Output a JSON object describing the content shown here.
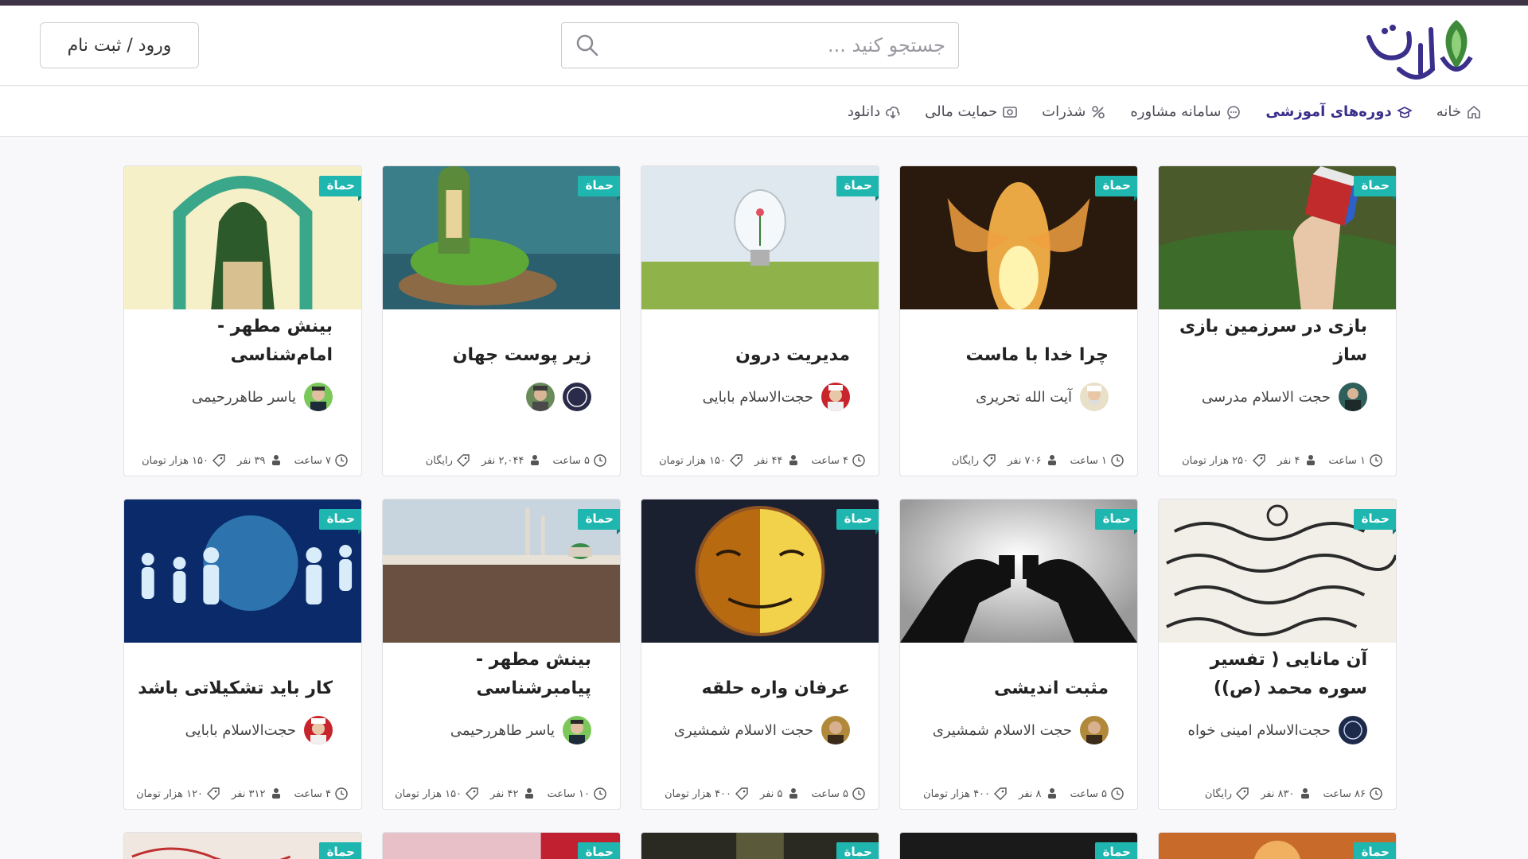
{
  "header": {
    "search_placeholder": "جستجو کنید ...",
    "login_label": "ورود / ثبت نام"
  },
  "nav": {
    "items": [
      {
        "label": "خانه",
        "icon": "home-icon"
      },
      {
        "label": "دوره‌های آموزشی",
        "icon": "course-icon"
      },
      {
        "label": "سامانه مشاوره",
        "icon": "consult-icon"
      },
      {
        "label": "شذرات",
        "icon": "percent-icon"
      },
      {
        "label": "حمایت مالی",
        "icon": "money-icon"
      },
      {
        "label": "دانلود",
        "icon": "download-icon"
      }
    ]
  },
  "badge": "حماة",
  "courses": [
    {
      "title": "بازی در سرزمین بازی ساز",
      "author": "حجت الاسلام مدرسی",
      "hours": "۱ ساعت",
      "people": "۴ نفر",
      "price": "۲۵۰ هزار تومان"
    },
    {
      "title": "چرا خدا با ماست",
      "author": "آیت الله تحریری",
      "hours": "۱ ساعت",
      "people": "۷۰۶ نفر",
      "price": "رایگان"
    },
    {
      "title": "مدیریت درون",
      "author": "حجت‌الاسلام بابایی",
      "hours": "۴ ساعت",
      "people": "۴۴ نفر",
      "price": "۱۵۰ هزار تومان"
    },
    {
      "title": "زیر پوست جهان",
      "author": "",
      "hours": "۵ ساعت",
      "people": "۲,۰۴۴ نفر",
      "price": "رایگان"
    },
    {
      "title": "بینش مطهر - امام‌شناسی",
      "author": "یاسر طاهررحیمی",
      "hours": "۷ ساعت",
      "people": "۳۹ نفر",
      "price": "۱۵۰ هزار تومان"
    },
    {
      "title": "آن مانایی ( تفسیر سوره محمد (ص))",
      "author": "حجت‌الاسلام امینی خواه",
      "hours": "۸۶ ساعت",
      "people": "۸۳۰ نفر",
      "price": "رایگان"
    },
    {
      "title": "مثبت اندیشی",
      "author": "حجت الاسلام شمشیری",
      "hours": "۵ ساعت",
      "people": "۸ نفر",
      "price": "۴۰۰ هزار تومان"
    },
    {
      "title": "عرفان واره حلقه",
      "author": "حجت الاسلام شمشیری",
      "hours": "۵ ساعت",
      "people": "۵ نفر",
      "price": "۴۰۰ هزار تومان"
    },
    {
      "title": "بینش مطهر - پیامبرشناسی",
      "author": "یاسر طاهررحیمی",
      "hours": "۱۰ ساعت",
      "people": "۴۲ نفر",
      "price": "۱۵۰ هزار تومان"
    },
    {
      "title": "کار باید تشکیلاتی باشد",
      "author": "حجت‌الاسلام بابایی",
      "hours": "۴ ساعت",
      "people": "۳۱۲ نفر",
      "price": "۱۲۰ هزار تومان"
    }
  ],
  "colors": {
    "badge": "#20b6b0",
    "brand_dark": "#3a2f8a",
    "top_strip": "#3f3446"
  }
}
